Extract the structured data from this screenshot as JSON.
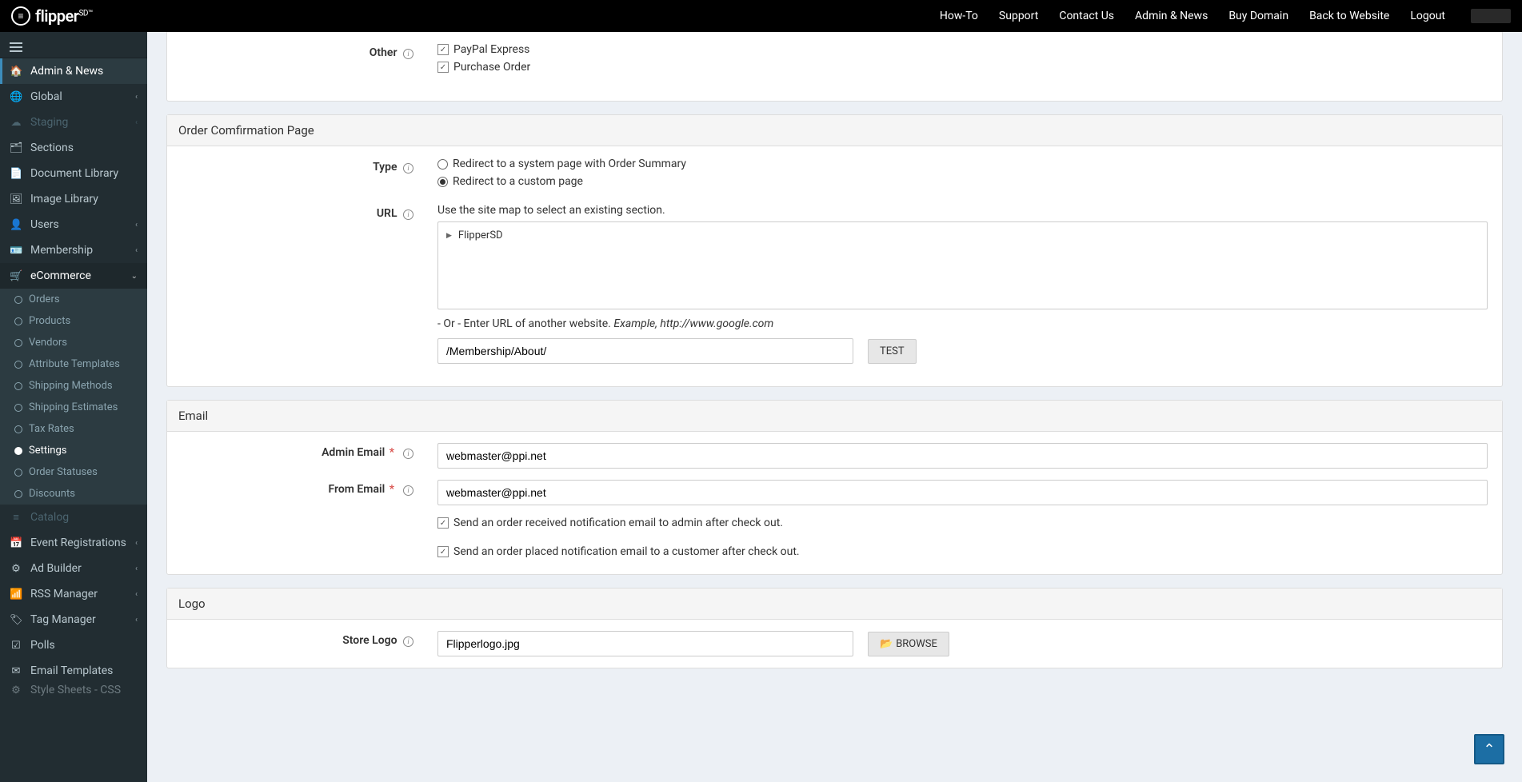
{
  "topnav": {
    "logo_text": "flipper",
    "logo_suffix": "SD™",
    "links": [
      "How-To",
      "Support",
      "Contact Us",
      "Admin & News",
      "Buy Domain",
      "Back to Website",
      "Logout"
    ]
  },
  "sidebar": {
    "items": [
      {
        "label": "Admin & News",
        "icon": "🏠",
        "active": true
      },
      {
        "label": "Global",
        "icon": "🌐",
        "expandable": true
      },
      {
        "label": "Staging",
        "icon": "☁",
        "expandable": true,
        "disabled": true
      },
      {
        "label": "Sections",
        "icon": "🗂"
      },
      {
        "label": "Document Library",
        "icon": "📄"
      },
      {
        "label": "Image Library",
        "icon": "🖼"
      },
      {
        "label": "Users",
        "icon": "👤",
        "expandable": true
      },
      {
        "label": "Membership",
        "icon": "🪪",
        "expandable": true
      },
      {
        "label": "eCommerce",
        "icon": "🛒",
        "expandable": true,
        "open": true
      }
    ],
    "ecommerce_sub": [
      "Orders",
      "Products",
      "Vendors",
      "Attribute Templates",
      "Shipping Methods",
      "Shipping Estimates",
      "Tax Rates",
      "Settings",
      "Order Statuses",
      "Discounts"
    ],
    "ecommerce_active": "Settings",
    "after": [
      {
        "label": "Catalog",
        "icon": "≡",
        "disabled": true
      },
      {
        "label": "Event Registrations",
        "icon": "📅",
        "expandable": true
      },
      {
        "label": "Ad Builder",
        "icon": "⚙",
        "expandable": true
      },
      {
        "label": "RSS Manager",
        "icon": "📶",
        "expandable": true
      },
      {
        "label": "Tag Manager",
        "icon": "🏷",
        "expandable": true
      },
      {
        "label": "Polls",
        "icon": "☑"
      },
      {
        "label": "Email Templates",
        "icon": "✉"
      },
      {
        "label": "Style Sheets - CSS",
        "icon": "⚙",
        "cut": true
      }
    ]
  },
  "panels": {
    "other": {
      "label": "Other",
      "paypal": "PayPal Express",
      "po": "Purchase Order"
    },
    "confirm": {
      "title": "Order Comfirmation Page",
      "type_label": "Type",
      "type_opt1": "Redirect to a system page with Order Summary",
      "type_opt2": "Redirect to a custom page",
      "url_label": "URL",
      "url_hint": "Use the site map to select an existing section.",
      "tree_root": "FlipperSD",
      "or_hint_a": "- Or - Enter URL of another website. ",
      "or_hint_b": "Example, http://www.google.com",
      "url_value": "/Membership/About/",
      "test_btn": "TEST"
    },
    "email": {
      "title": "Email",
      "admin_label": "Admin Email",
      "from_label": "From Email",
      "admin_value": "webmaster@ppi.net",
      "from_value": "webmaster@ppi.net",
      "chk1": "Send an order received notification email to admin after check out.",
      "chk2": "Send an order placed notification email to a customer after check out."
    },
    "logo": {
      "title": "Logo",
      "label": "Store Logo",
      "value": "Flipperlogo.jpg",
      "browse": "BROWSE"
    }
  }
}
